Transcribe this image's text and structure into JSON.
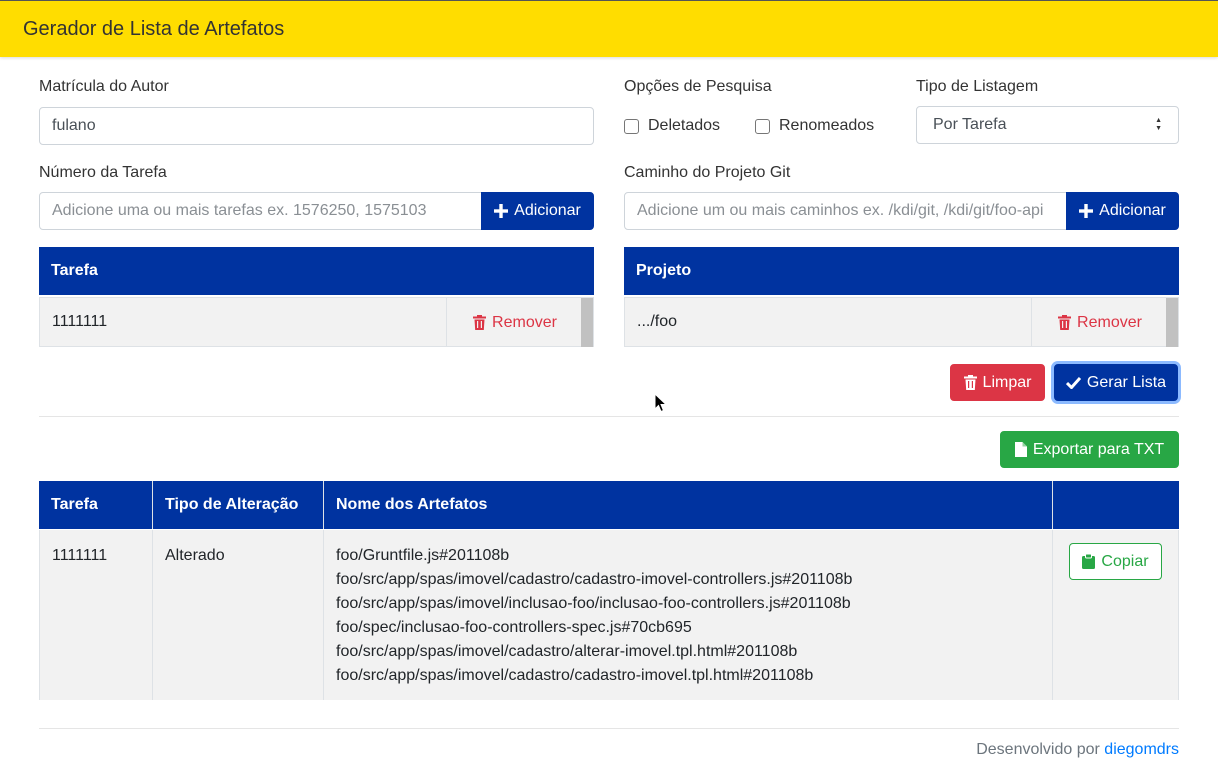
{
  "header": {
    "title": "Gerador de Lista de Artefatos",
    "color": "#ffdd00"
  },
  "form": {
    "author": {
      "label": "Matrícula do Autor",
      "value": "fulano"
    },
    "search_options": {
      "label": "Opções de Pesquisa",
      "deleted": {
        "label": "Deletados",
        "checked": false
      },
      "renamed": {
        "label": "Renomeados",
        "checked": false
      }
    },
    "listing_type": {
      "label": "Tipo de Listagem",
      "value": "Por Tarefa"
    },
    "task_number": {
      "label": "Número da Tarefa",
      "placeholder": "Adicione uma ou mais tarefas ex. 1576250, 1575103",
      "add_label": "Adicionar"
    },
    "git_path": {
      "label": "Caminho do Projeto Git",
      "placeholder": "Adicione um ou mais caminhos ex. /kdi/git, /kdi/git/foo-api",
      "add_label": "Adicionar"
    }
  },
  "tasks_table": {
    "header": "Tarefa",
    "rows": [
      {
        "value": "1111111",
        "remove_label": "Remover"
      }
    ]
  },
  "projects_table": {
    "header": "Projeto",
    "rows": [
      {
        "value": ".../foo",
        "remove_label": "Remover"
      }
    ]
  },
  "actions": {
    "clear_label": "Limpar",
    "generate_label": "Gerar Lista"
  },
  "export": {
    "label": "Exportar para TXT"
  },
  "results": {
    "columns": [
      "Tarefa",
      "Tipo de Alteração",
      "Nome dos Artefatos",
      ""
    ],
    "rows": [
      {
        "task": "1111111",
        "change_type": "Alterado",
        "artifacts": [
          "foo/Gruntfile.js#201108b",
          "foo/src/app/spas/imovel/cadastro/cadastro-imovel-controllers.js#201108b",
          "foo/src/app/spas/imovel/inclusao-foo/inclusao-foo-controllers.js#201108b",
          "foo/spec/inclusao-foo-controllers-spec.js#70cb695",
          "foo/src/app/spas/imovel/cadastro/alterar-imovel.tpl.html#201108b",
          "foo/src/app/spas/imovel/cadastro/cadastro-imovel.tpl.html#201108b"
        ],
        "copy_label": "Copiar"
      }
    ]
  },
  "footer": {
    "text": "Desenvolvido por",
    "link": "diegomdrs"
  },
  "colors": {
    "primary": "#0033a0",
    "danger": "#dc3545",
    "success": "#28a745",
    "link": "#007bff"
  }
}
